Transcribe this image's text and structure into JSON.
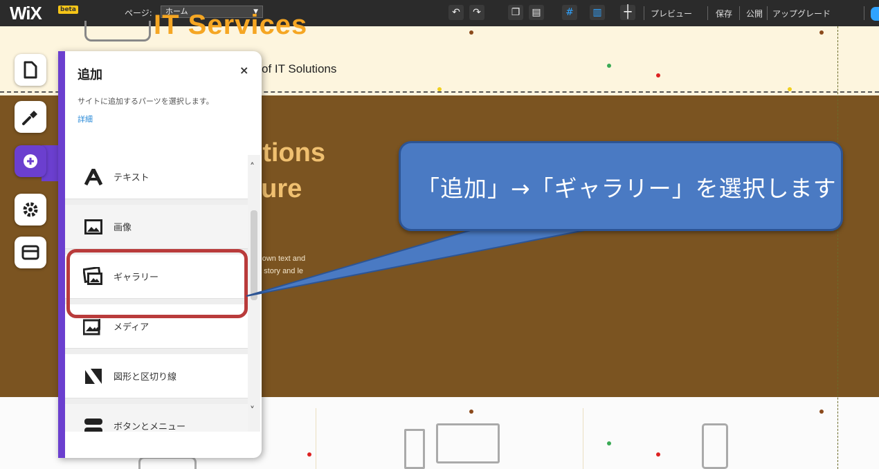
{
  "toolbar": {
    "logo": "WiX",
    "beta": "beta",
    "page_label": "ページ:",
    "page_select": "ホーム",
    "preview": "プレビュー",
    "save": "保存",
    "publish": "公開",
    "upgrade": "アップグレード",
    "icons": [
      "undo-icon",
      "redo-icon",
      "copy-icon",
      "paste-icon",
      "grid-icon",
      "gridlines-icon",
      "ruler-icon"
    ]
  },
  "site": {
    "title": "IT Services",
    "subtitle": "of IT Solutions",
    "hero_line1": "utions",
    "hero_line2": "cure",
    "hero_body1": "r own text and",
    "hero_body2": "a story and le"
  },
  "left_rail": {
    "items": [
      "pages-icon",
      "design-icon",
      "add-icon",
      "settings-icon",
      "store-icon"
    ],
    "active": "add-icon"
  },
  "add_panel": {
    "title": "追加",
    "close": "×",
    "description": "サイトに追加するパーツを選択します。",
    "help_link": "詳細",
    "items": [
      {
        "label": "テキスト",
        "icon": "text-icon"
      },
      {
        "label": "画像",
        "icon": "image-icon"
      },
      {
        "label": "ギャラリー",
        "icon": "gallery-icon"
      },
      {
        "label": "メディア",
        "icon": "media-icon"
      },
      {
        "label": "図形と区切り線",
        "icon": "shapes-icon"
      },
      {
        "label": "ボタンとメニュー",
        "icon": "buttons-icon"
      }
    ]
  },
  "annotation": {
    "callout_text": "「追加」→「ギャラリー」を選択します",
    "highlight_color": "#b93b3b",
    "callout_color": "#4a7ac3"
  },
  "colors": {
    "accent": "#6b3fcf",
    "hero_bg": "#7b5421",
    "header_bg": "#fdf5de",
    "title_orange": "#f5a623"
  }
}
